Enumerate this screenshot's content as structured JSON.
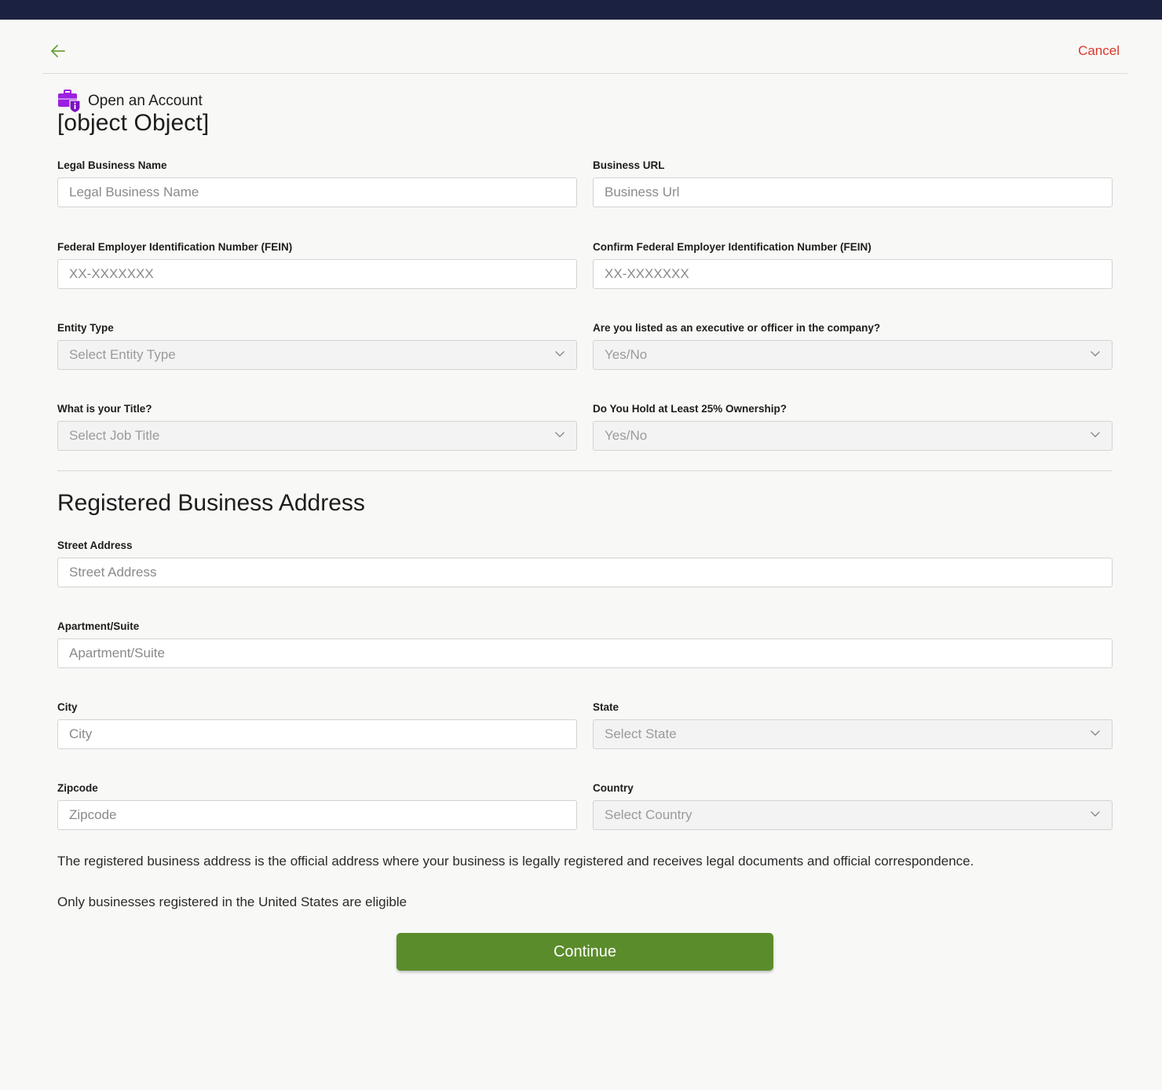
{
  "header": {
    "cancel_label": "Cancel"
  },
  "brand": {
    "label": "Open an Account"
  },
  "section1": {
    "title": {
      "label": "What is your Title?",
      "placeholder": "Select Job Title"
    },
    "legal_name": {
      "label": "Legal Business Name",
      "placeholder": "Legal Business Name"
    },
    "business_url": {
      "label": "Business URL",
      "placeholder": "Business Url"
    },
    "fein": {
      "label": "Federal Employer Identification Number (FEIN)",
      "placeholder": "XX-XXXXXXX"
    },
    "confirm_fein": {
      "label": "Confirm Federal Employer Identification Number (FEIN)",
      "placeholder": "XX-XXXXXXX"
    },
    "entity_type": {
      "label": "Entity Type",
      "placeholder": "Select Entity Type"
    },
    "executive": {
      "label": "Are you listed as an executive or officer in the company?",
      "placeholder": "Yes/No"
    },
    "ownership": {
      "label": "Do You Hold at Least 25% Ownership?",
      "placeholder": "Yes/No"
    }
  },
  "section2": {
    "title": "Registered Business Address",
    "street": {
      "label": "Street Address",
      "placeholder": "Street Address"
    },
    "apartment": {
      "label": "Apartment/Suite",
      "placeholder": "Apartment/Suite"
    },
    "city": {
      "label": "City",
      "placeholder": "City"
    },
    "state": {
      "label": "State",
      "placeholder": "Select State"
    },
    "zipcode": {
      "label": "Zipcode",
      "placeholder": "Zipcode"
    },
    "country": {
      "label": "Country",
      "placeholder": "Select Country"
    }
  },
  "notes": {
    "address_note": "The registered business address is the official address where your business is legally registered and receives legal documents and official correspondence.",
    "eligibility_note": "Only businesses registered in the United States are eligible"
  },
  "continue_label": "Continue",
  "colors": {
    "accent": "#5b8c2b",
    "cancel": "#d9392b",
    "brand_icon": "#9b1fe0",
    "topbar": "#1b2140"
  }
}
